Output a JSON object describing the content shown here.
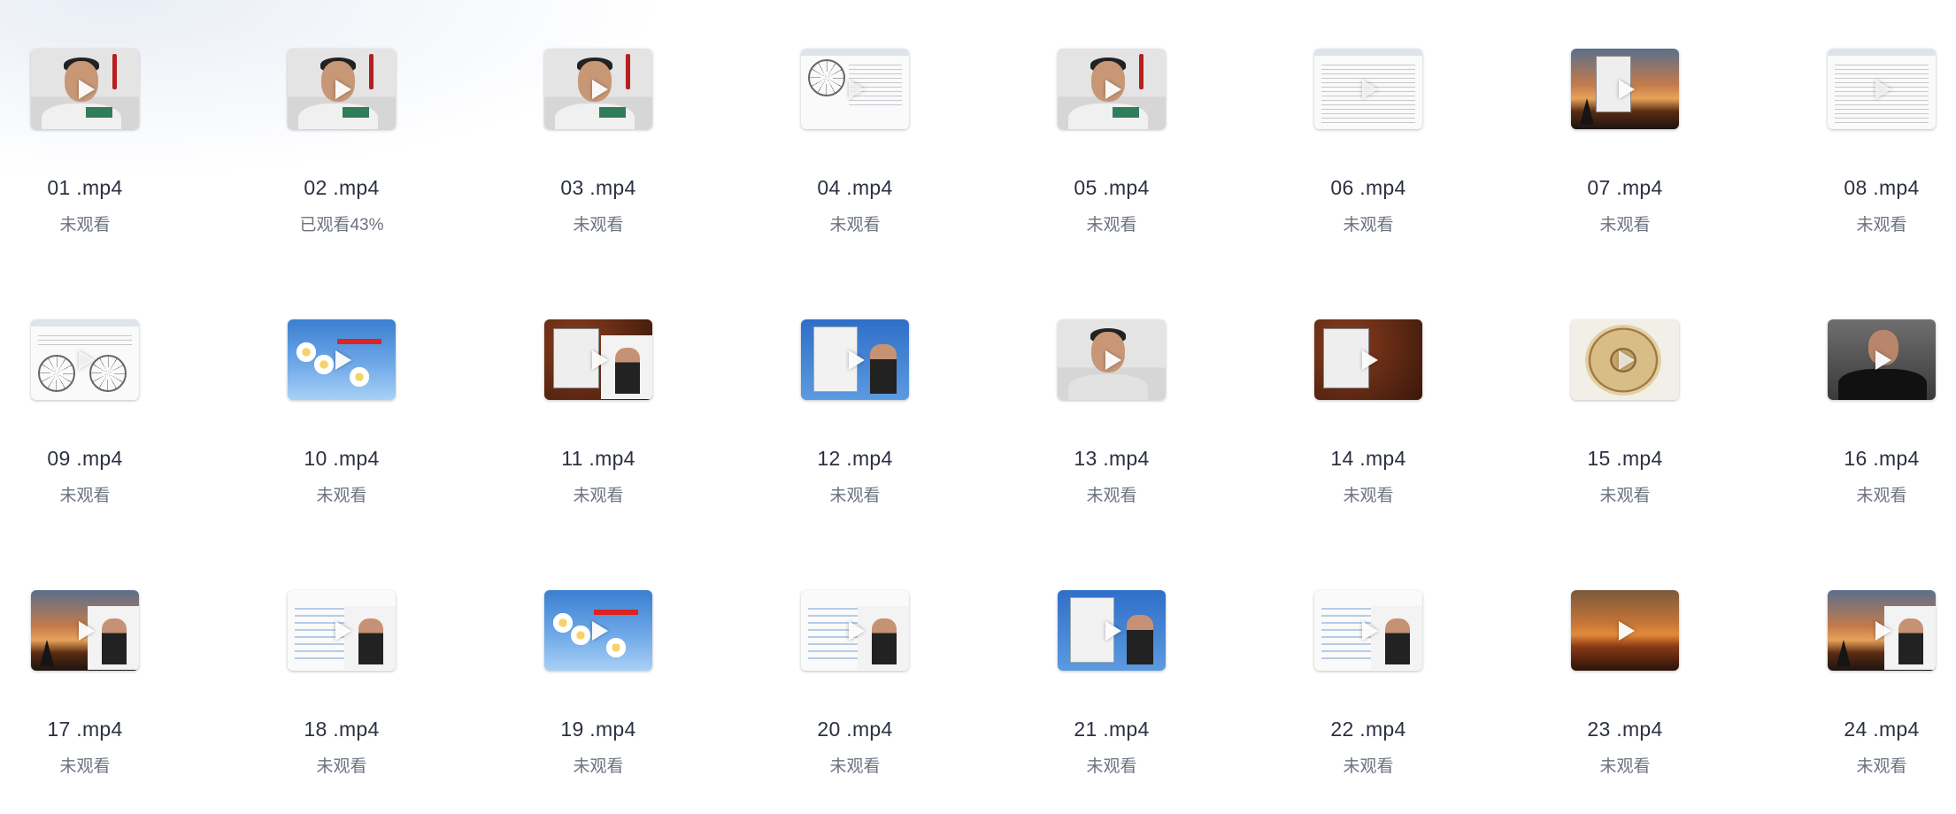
{
  "videos": [
    {
      "name": "01 .mp4",
      "status": "未观看",
      "thumb": "person"
    },
    {
      "name": "02 .mp4",
      "status": "已观看43%",
      "thumb": "person"
    },
    {
      "name": "03 .mp4",
      "status": "未观看",
      "thumb": "person"
    },
    {
      "name": "04 .mp4",
      "status": "未观看",
      "thumb": "doc-wheel"
    },
    {
      "name": "05 .mp4",
      "status": "未观看",
      "thumb": "person"
    },
    {
      "name": "06 .mp4",
      "status": "未观看",
      "thumb": "doc"
    },
    {
      "name": "07 .mp4",
      "status": "未观看",
      "thumb": "sunset-window"
    },
    {
      "name": "08 .mp4",
      "status": "未观看",
      "thumb": "doc"
    },
    {
      "name": "09 .mp4",
      "status": "未观看",
      "thumb": "doc-wheels"
    },
    {
      "name": "10 .mp4",
      "status": "未观看",
      "thumb": "flower"
    },
    {
      "name": "11 .mp4",
      "status": "未观看",
      "thumb": "coffee-person"
    },
    {
      "name": "12 .mp4",
      "status": "未观看",
      "thumb": "desktop-person"
    },
    {
      "name": "13 .mp4",
      "status": "未观看",
      "thumb": "person-light"
    },
    {
      "name": "14 .mp4",
      "status": "未观看",
      "thumb": "coffee-window"
    },
    {
      "name": "15 .mp4",
      "status": "未观看",
      "thumb": "compass"
    },
    {
      "name": "16 .mp4",
      "status": "未观看",
      "thumb": "person-dark"
    },
    {
      "name": "17 .mp4",
      "status": "未观看",
      "thumb": "sunset-person"
    },
    {
      "name": "18 .mp4",
      "status": "未观看",
      "thumb": "chart-person"
    },
    {
      "name": "19 .mp4",
      "status": "未观看",
      "thumb": "flower"
    },
    {
      "name": "20 .mp4",
      "status": "未观看",
      "thumb": "chart-person"
    },
    {
      "name": "21 .mp4",
      "status": "未观看",
      "thumb": "desktop-person"
    },
    {
      "name": "22 .mp4",
      "status": "未观看",
      "thumb": "chart-person"
    },
    {
      "name": "23 .mp4",
      "status": "未观看",
      "thumb": "sunset"
    },
    {
      "name": "24 .mp4",
      "status": "未观看",
      "thumb": "sunset-person"
    }
  ],
  "icons": {
    "play": "play-icon"
  }
}
